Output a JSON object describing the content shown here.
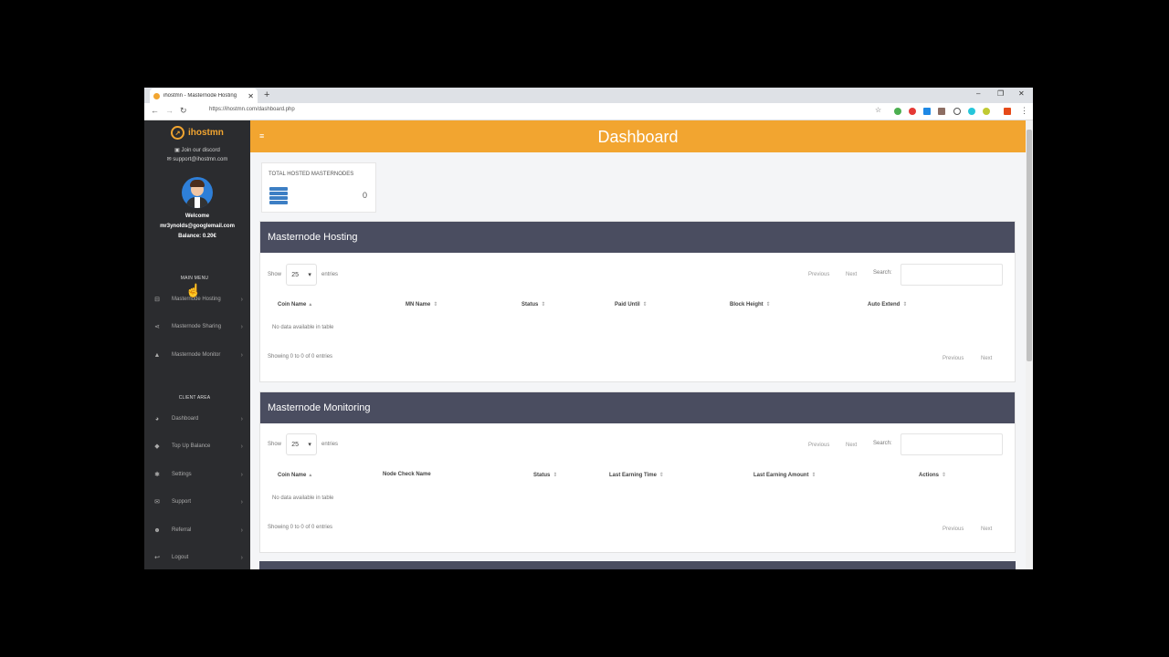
{
  "browser": {
    "tab_title": "ihostmn - Masternode Hosting",
    "tab_close": "✕",
    "new_tab": "+",
    "url": "https://ihostmn.com/dashboard.php",
    "win_min": "–",
    "win_max": "❐",
    "win_close": "✕"
  },
  "sidebar": {
    "brand": "ihostmn",
    "discord": "Join our discord",
    "email": "support@ihostmn.com",
    "welcome": "Welcome",
    "user_email": "mr3ynolds@googlemail.com",
    "balance": "Balance: 0.20€",
    "main_menu_title": "MAIN MENU",
    "main_menu": [
      {
        "label": "Masternode Hosting",
        "icon": "hdd-icon"
      },
      {
        "label": "Masternode Sharing",
        "icon": "share-icon"
      },
      {
        "label": "Masternode Monitor",
        "icon": "chart-icon"
      }
    ],
    "client_area_title": "CLIENT AREA",
    "client_area": [
      {
        "label": "Dashboard",
        "icon": "dashboard-icon"
      },
      {
        "label": "Top Up Balance",
        "icon": "tag-icon"
      },
      {
        "label": "Settings",
        "icon": "gear-icon"
      },
      {
        "label": "Support",
        "icon": "envelope-icon"
      },
      {
        "label": "Referral",
        "icon": "users-icon"
      },
      {
        "label": "Logout",
        "icon": "logout-icon"
      }
    ]
  },
  "header": {
    "title": "Dashboard"
  },
  "stats": {
    "label": "TOTAL HOSTED MASTERNODES",
    "value": "0"
  },
  "hosting": {
    "title": "Masternode Hosting",
    "show": "Show",
    "entries_value": "25",
    "entries": "entries",
    "previous": "Previous",
    "next": "Next",
    "search": "Search:",
    "columns": [
      "Coin Name",
      "MN Name",
      "Status",
      "Paid Until",
      "Block Height",
      "Auto Extend"
    ],
    "empty": "No data available in table",
    "info": "Showing 0 to 0 of 0 entries"
  },
  "monitoring": {
    "title": "Masternode Monitoring",
    "show": "Show",
    "entries_value": "25",
    "entries": "entries",
    "previous": "Previous",
    "next": "Next",
    "search": "Search:",
    "columns": [
      "Coin Name",
      "Node Check Name",
      "Status",
      "Last Earning Time",
      "Last Earning Amount",
      "Actions"
    ],
    "empty": "No data available in table",
    "info": "Showing 0 to 0 of 0 entries"
  },
  "colors": {
    "accent": "#f2a530",
    "sidebar_bg": "#2b2c2f",
    "panel_head": "#4a4d60"
  }
}
